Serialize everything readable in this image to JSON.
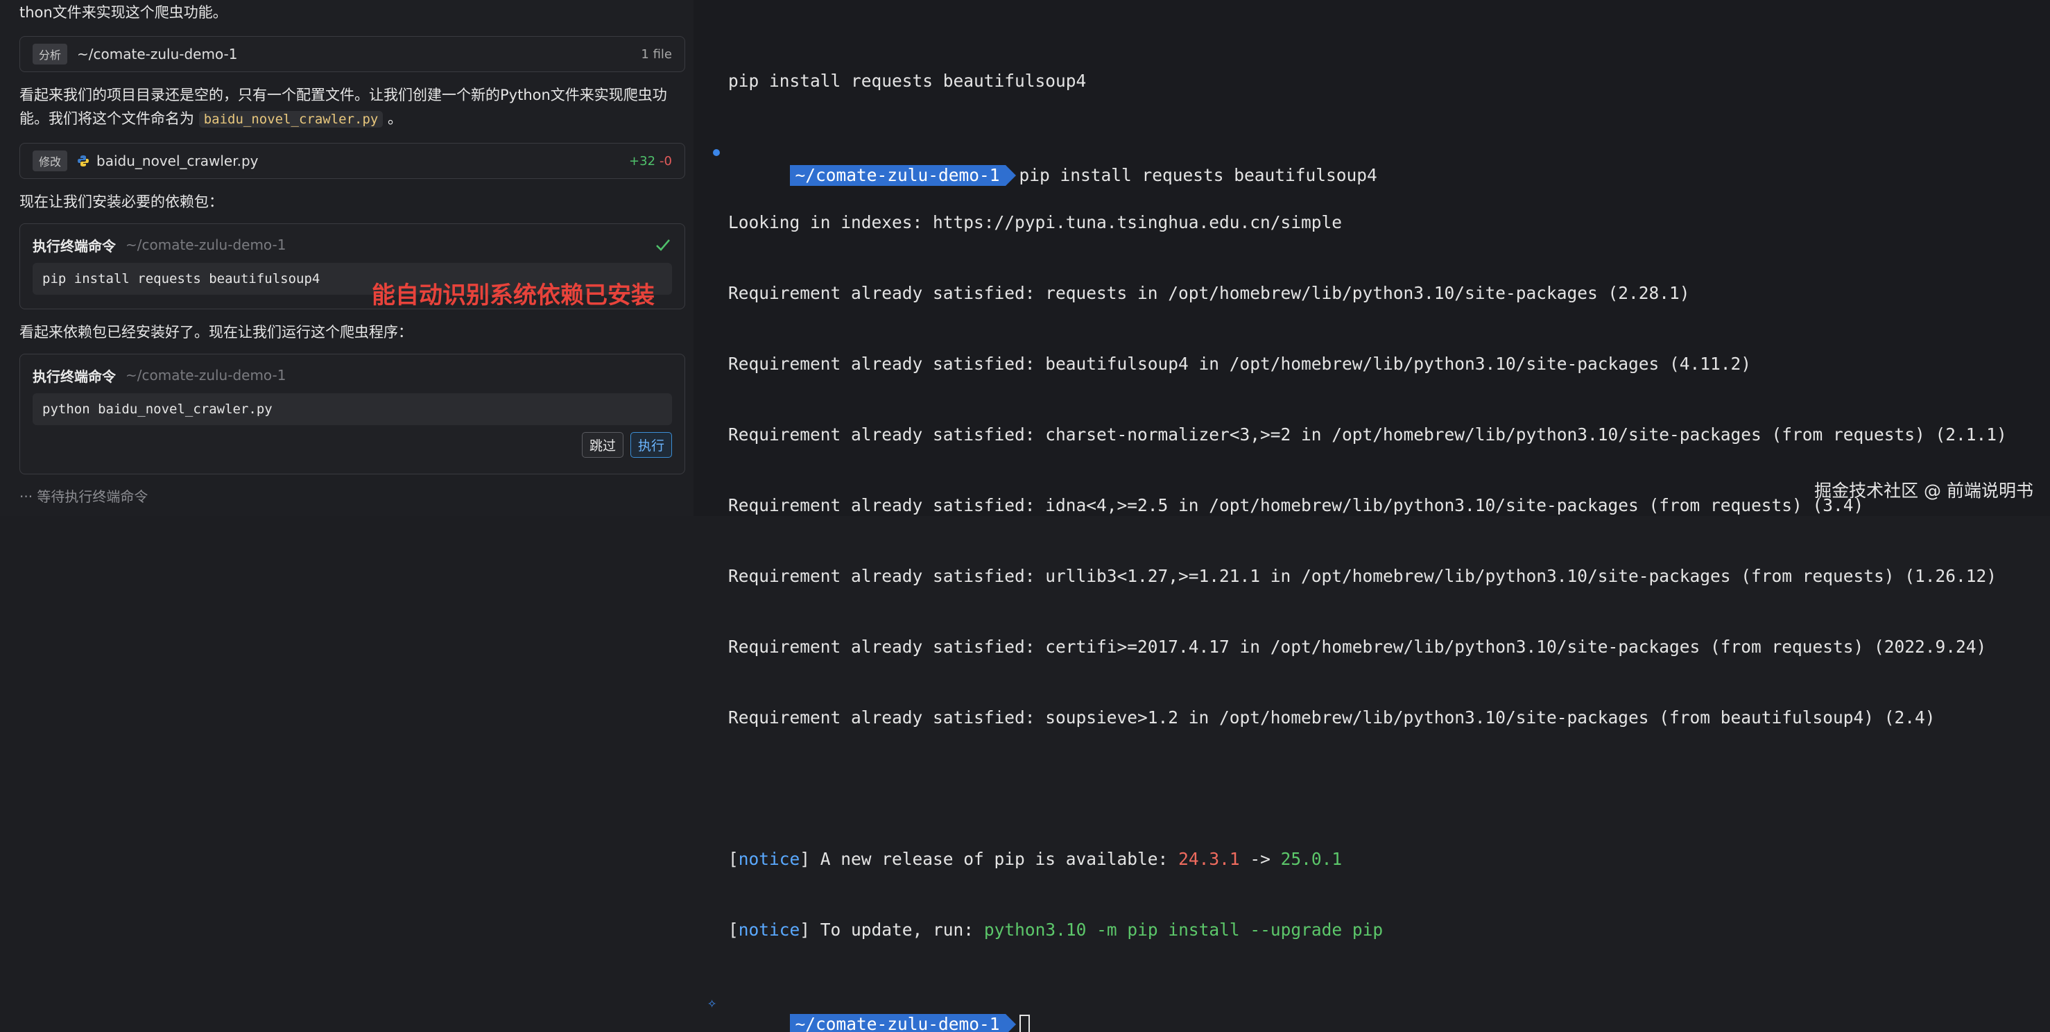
{
  "left": {
    "p1": "thon文件来实现这个爬虫功能。",
    "card_analyze": {
      "tag": "分析",
      "path": "~/comate-zulu-demo-1",
      "note": "1 file"
    },
    "p2_line1": "看起来我们的项目目录还是空的，只有一个配置文件。让我们创建一个新的Python文件来实现爬虫功",
    "p2_line2_pre": "能。我们将这个文件命名为",
    "p2_code": "baidu_novel_crawler.py",
    "p2_line2_post": "。",
    "card_modify": {
      "tag": "修改",
      "file": "baidu_novel_crawler.py",
      "added": "+32",
      "removed": "-0"
    },
    "p3": "现在让我们安装必要的依赖包：",
    "term1": {
      "title": "执行终端命令",
      "cwd": "~/comate-zulu-demo-1",
      "command": "pip install requests beautifulsoup4"
    },
    "annotation": "能自动识别系统依赖已安装",
    "p4": "看起来依赖包已经安装好了。现在让我们运行这个爬虫程序：",
    "term2": {
      "title": "执行终端命令",
      "cwd": "~/comate-zulu-demo-1",
      "command": "python baidu_novel_crawler.py",
      "skip_label": "跳过",
      "run_label": "执行"
    },
    "waiting": "··· 等待执行终端命令"
  },
  "terminal": {
    "line0": "pip install requests beautifulsoup4",
    "prompt_path": "~/comate-zulu-demo-1",
    "command": "pip install requests beautifulsoup4",
    "lines": [
      "Looking in indexes: https://pypi.tuna.tsinghua.edu.cn/simple",
      "Requirement already satisfied: requests in /opt/homebrew/lib/python3.10/site-packages (2.28.1)",
      "Requirement already satisfied: beautifulsoup4 in /opt/homebrew/lib/python3.10/site-packages (4.11.2)",
      "Requirement already satisfied: charset-normalizer<3,>=2 in /opt/homebrew/lib/python3.10/site-packages (from requests) (2.1.1)",
      "Requirement already satisfied: idna<4,>=2.5 in /opt/homebrew/lib/python3.10/site-packages (from requests) (3.4)",
      "Requirement already satisfied: urllib3<1.27,>=1.21.1 in /opt/homebrew/lib/python3.10/site-packages (from requests) (1.26.12)",
      "Requirement already satisfied: certifi>=2017.4.17 in /opt/homebrew/lib/python3.10/site-packages (from requests) (2022.9.24)",
      "Requirement already satisfied: soupsieve>1.2 in /opt/homebrew/lib/python3.10/site-packages (from beautifulsoup4) (2.4)"
    ],
    "notice1": {
      "tag": "notice",
      "text": "A new release of pip is available: ",
      "old": "24.3.1",
      "arrow": " -> ",
      "new": "25.0.1"
    },
    "notice2": {
      "tag": "notice",
      "text": "To update, run: ",
      "cmd": "python3.10 -m pip install --upgrade pip"
    },
    "prompt2_path": "~/comate-zulu-demo-1"
  },
  "watermark": "掘金技术社区 @ 前端说明书",
  "colors": {
    "prompt_bg": "#2f6fd0",
    "annotation": "#e8433b",
    "added": "#4fc16b",
    "removed": "#e35b5b"
  }
}
